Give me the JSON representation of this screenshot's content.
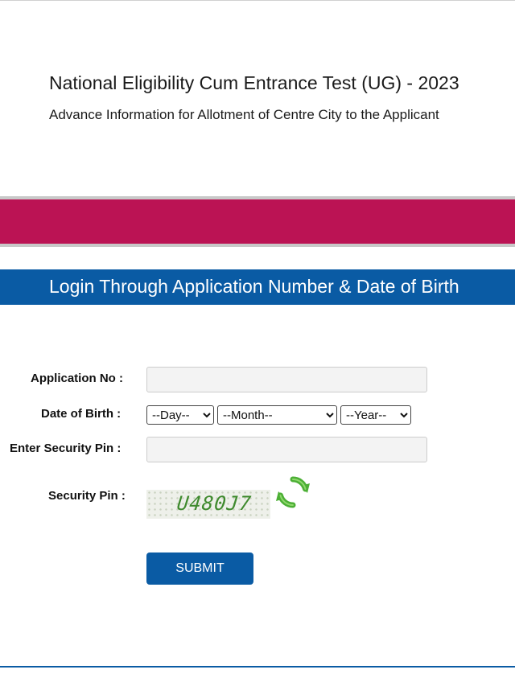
{
  "header": {
    "title": "National Eligibility Cum Entrance Test (UG) - 2023",
    "subtitle": "Advance Information for Allotment of Centre City to the Applicant"
  },
  "login": {
    "heading": "Login Through Application Number & Date of Birth"
  },
  "form": {
    "application_no_label": "Application No :",
    "application_no_value": "",
    "dob_label": "Date of Birth :",
    "dob_day_selected": "--Day--",
    "dob_month_selected": "--Month--",
    "dob_year_selected": "--Year--",
    "security_pin_input_label": "Enter Security Pin :",
    "security_pin_input_value": "",
    "security_pin_label": "Security Pin :",
    "captcha_text": "U480J7",
    "submit_label": "SUBMIT"
  },
  "colors": {
    "brand_band": "#bb1354",
    "primary_blue": "#0a5ba4",
    "captcha_text": "#3f8a2e",
    "refresh_icon": "#4caf35"
  },
  "icons": {
    "refresh": "refresh-captcha-icon"
  }
}
